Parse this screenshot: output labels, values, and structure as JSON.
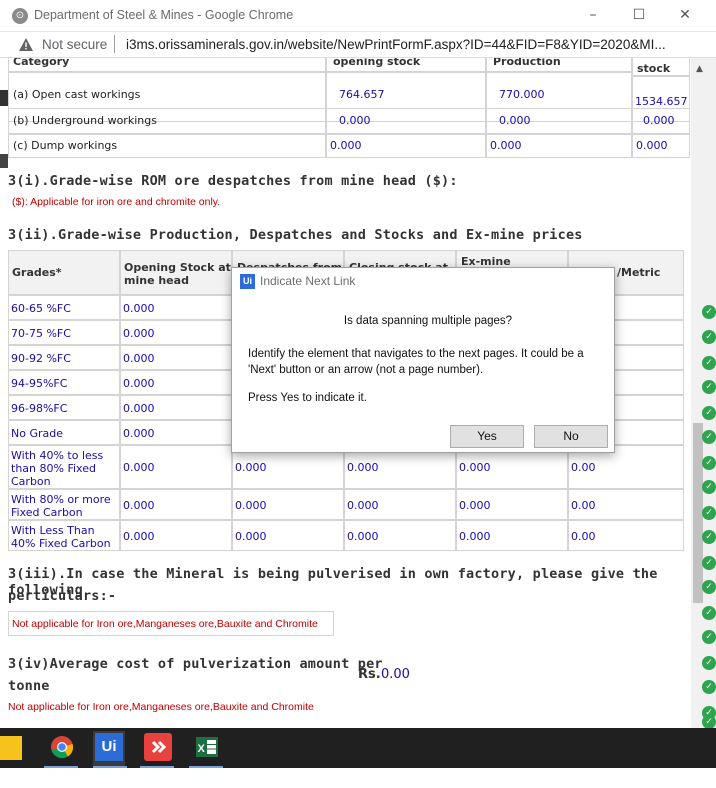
{
  "window": {
    "title": "Department of Steel & Mines - Google Chrome",
    "minimize": "–",
    "maximize": "☐",
    "close": "✕"
  },
  "address": {
    "security": "Not secure",
    "url": "i3ms.orissaminerals.gov.in/website/NewPrintFormF.aspx?ID=44&FID=F8&YID=2020&MI..."
  },
  "table1": {
    "headers": [
      "Category",
      "opening stock",
      "Production",
      "stock"
    ],
    "rows": [
      {
        "label": "(a) Open cast workings",
        "a": "764.657",
        "b": "770.000",
        "c": "1534.657"
      },
      {
        "label": "(b) Underground workings",
        "a": "0.000",
        "b": "0.000",
        "c": "0.000"
      },
      {
        "label": "(c) Dump workings",
        "a": "0.000",
        "b": "0.000",
        "c": "0.000"
      }
    ]
  },
  "section3i": {
    "title": "3(i).Grade-wise ROM ore despatches from mine head ($):",
    "note": "($): Applicable for iron ore and chromite only."
  },
  "section3ii": {
    "title": "3(ii).Grade-wise Production, Despatches and Stocks and Ex-mine prices",
    "headers": [
      "Grades*",
      "Opening Stock at mine head",
      "Despatches from",
      "Closing stock at",
      "Ex-mine",
      "/Metric"
    ],
    "rows": [
      {
        "grade": "60-65 %FC",
        "v": [
          "0.000",
          "",
          "",
          "",
          ""
        ]
      },
      {
        "grade": "70-75 %FC",
        "v": [
          "0.000",
          "",
          "",
          "",
          ""
        ]
      },
      {
        "grade": "90-92 %FC",
        "v": [
          "0.000",
          "",
          "",
          "",
          ""
        ]
      },
      {
        "grade": "94-95%FC",
        "v": [
          "0.000",
          "",
          "",
          "",
          ""
        ]
      },
      {
        "grade": "96-98%FC",
        "v": [
          "0.000",
          "",
          "",
          "",
          ""
        ]
      },
      {
        "grade": "No Grade",
        "v": [
          "0.000",
          "",
          "",
          "",
          ""
        ]
      },
      {
        "grade": "With 40% to less than 80% Fixed Carbon",
        "v": [
          "0.000",
          "0.000",
          "0.000",
          "0.000",
          "0.00"
        ]
      },
      {
        "grade": "With 80% or more Fixed Carbon",
        "v": [
          "0.000",
          "0.000",
          "0.000",
          "0.000",
          "0.00"
        ]
      },
      {
        "grade": "With Less Than 40% Fixed Carbon",
        "v": [
          "0.000",
          "0.000",
          "0.000",
          "0.000",
          "0.00"
        ]
      }
    ]
  },
  "section3iii": {
    "title_line1": "3(iii).In case the Mineral is being  pulverised in own factory, please give the following",
    "title_line2": "perticulars:-",
    "note": "Not applicable for Iron ore,Manganeses ore,Bauxite and Chromite"
  },
  "section3iv": {
    "title_line1": "3(iv)Average cost of pulverization amount per",
    "title_line2": "tonne",
    "rs_label": "Rs.",
    "rs_value": "0.00",
    "note": "Not applicable for Iron ore,Manganeses ore,Bauxite and Chromite"
  },
  "dialog": {
    "app_icon": "Ui",
    "title": "Indicate Next Link",
    "question": "Is data spanning multiple pages?",
    "body": "Identify the element that navigates to the next pages. It could be a 'Next' button or an arrow (not a page number).",
    "press": "Press Yes to indicate it.",
    "yes": "Yes",
    "no": "No"
  },
  "taskbar": {
    "items": [
      "sticky-notes-icon",
      "chrome-icon",
      "uipath-icon",
      "git-icon",
      "excel-icon"
    ],
    "uipath_label": "Ui"
  },
  "colors": {
    "link": "#1a0dab",
    "note": "#c00000",
    "dialog_accent": "#2b6cd6",
    "taskbar": "#202020"
  }
}
